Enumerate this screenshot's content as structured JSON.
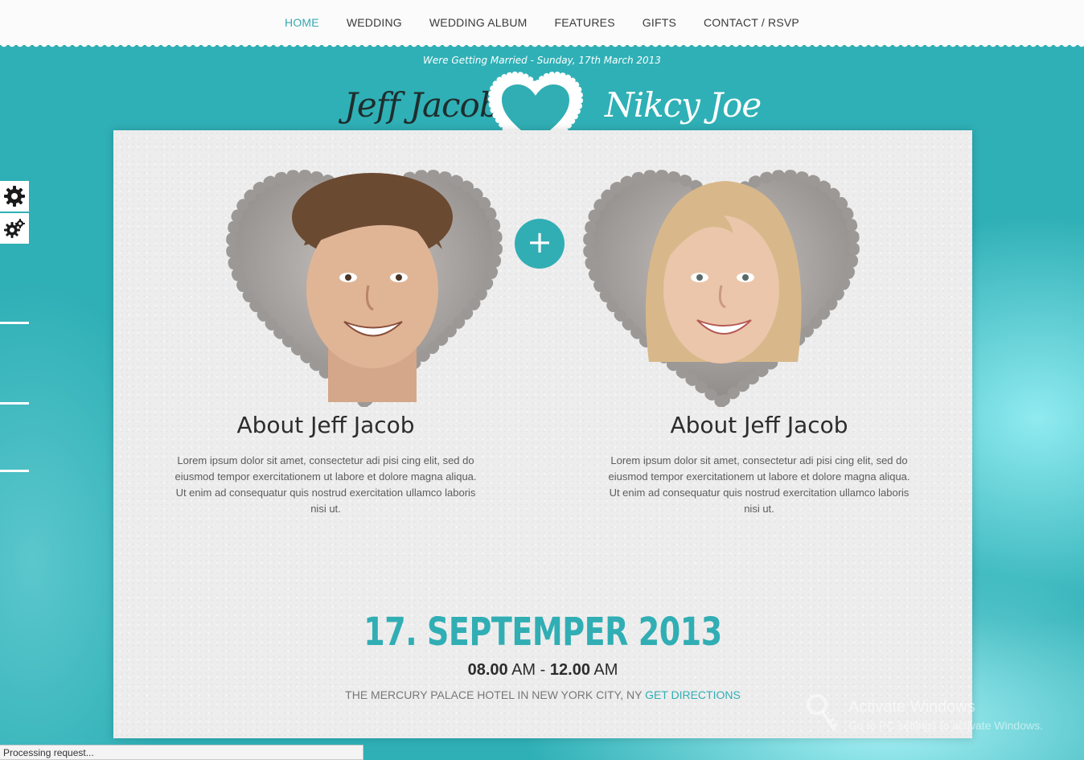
{
  "nav": {
    "items": [
      {
        "label": "HOME",
        "active": true
      },
      {
        "label": "WEDDING",
        "active": false
      },
      {
        "label": "WEDDING ALBUM",
        "active": false
      },
      {
        "label": "FEATURES",
        "active": false
      },
      {
        "label": "GIFTS",
        "active": false
      },
      {
        "label": "CONTACT / RSVP",
        "active": false
      }
    ]
  },
  "banner": {
    "tagline": "Were Getting Married - Sunday, 17th March 2013",
    "groom_name": "Jeff Jacob",
    "bride_name": "Nikcy Joe"
  },
  "side_tools": {
    "icons": [
      "gear-icon",
      "gears-icon"
    ]
  },
  "couple": {
    "groom": {
      "title": "About Jeff Jacob",
      "text": "Lorem ipsum dolor sit amet, consectetur adi pisi cing elit, sed do eiusmod tempor exercitationem ut labore et dolore magna aliqua. Ut enim ad consequatur quis nostrud exercitation ullamco laboris nisi ut."
    },
    "bride": {
      "title": "About Jeff Jacob",
      "text": "Lorem ipsum dolor sit amet, consectetur adi pisi cing elit, sed do eiusmod tempor exercitationem ut labore et dolore magna aliqua. Ut enim ad consequatur quis nostrud exercitation ullamco laboris nisi ut."
    },
    "plus_symbol": "+"
  },
  "event": {
    "date": "17. SEPTEMPER 2013",
    "start_time": "08.00",
    "start_period": "AM",
    "separator": "-",
    "end_time": "12.00",
    "end_period": "AM",
    "venue": "THE MERCURY PALACE HOTEL IN NEW YORK CITY, NY",
    "directions_label": "GET DIRECTIONS"
  },
  "watermark": {
    "title": "Activate Windows",
    "subtitle": "Go to PC settings to activate Windows."
  },
  "status_bar": {
    "text": "Processing request..."
  },
  "colors": {
    "accent": "#30aeb4",
    "background": "#2fb0b6",
    "card": "#ededed"
  }
}
